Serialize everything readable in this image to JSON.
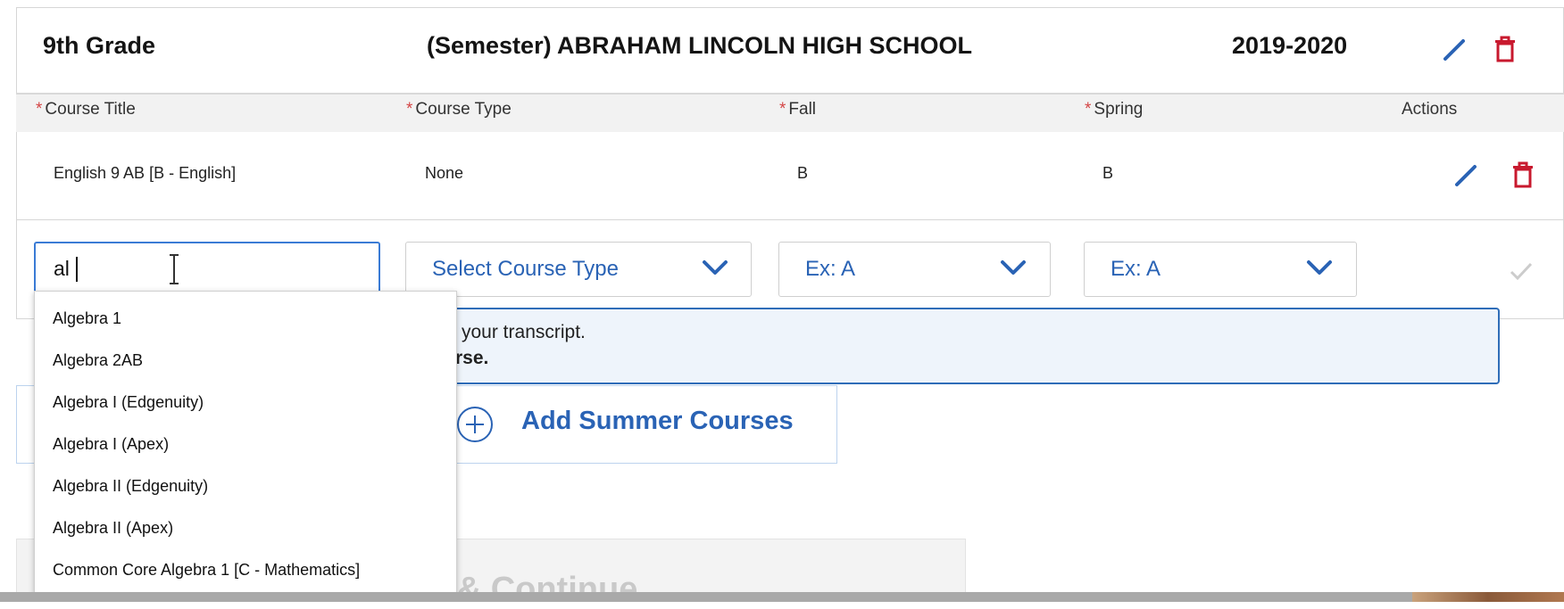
{
  "semester": {
    "grade": "9th Grade",
    "school": "(Semester) ABRAHAM LINCOLN HIGH SCHOOL",
    "year": "2019-2020"
  },
  "table": {
    "columns": [
      "Course Title",
      "Course Type",
      "Fall",
      "Spring",
      "Actions"
    ],
    "rows": [
      {
        "title": "English 9 AB [B - English]",
        "type": "None",
        "fall": "B",
        "spring": "B"
      }
    ]
  },
  "new_row": {
    "title_value": "al",
    "course_type_placeholder": "Select Course Type",
    "fall_placeholder": "Ex: A",
    "spring_placeholder": "Ex: A"
  },
  "autocomplete": [
    "Algebra 1",
    "Algebra 2AB",
    "Algebra I (Edgenuity)",
    "Algebra I (Apex)",
    "Algebra II (Edgenuity)",
    "Algebra II (Apex)",
    "Common Core Algebra 1 [C - Mathematics]"
  ],
  "info": {
    "line1": "your transcript.",
    "line2": "rse."
  },
  "summer_button": "Add Summer Courses",
  "save_button": "e & Continue",
  "colors": {
    "accent": "#2a63b5",
    "delete": "#c8192e",
    "required": "#d44646"
  }
}
